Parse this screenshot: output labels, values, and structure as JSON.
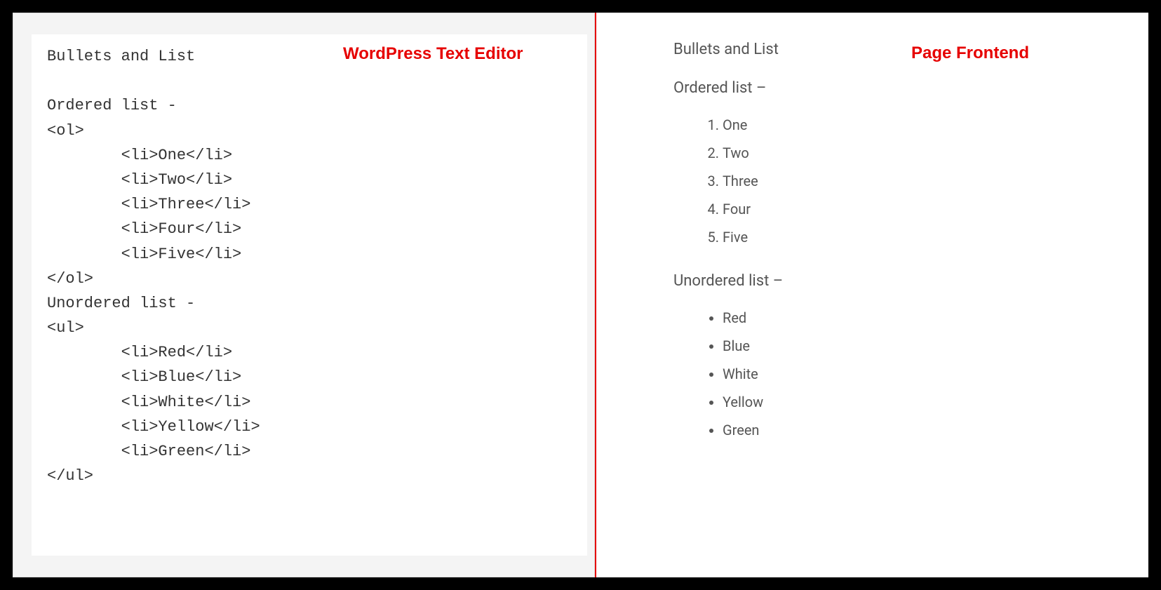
{
  "labels": {
    "left": "WordPress Text Editor",
    "right": "Page Frontend"
  },
  "editor": {
    "title_line": "Bullets and List",
    "ordered_header": "Ordered list -",
    "ol_open": "<ol>",
    "ol_items": [
      "One",
      "Two",
      "Three",
      "Four",
      "Five"
    ],
    "ol_close": "</ol>",
    "unordered_header": "Unordered list -",
    "ul_open": "<ul>",
    "ul_items": [
      "Red",
      "Blue",
      "White",
      "Yellow",
      "Green"
    ],
    "ul_close": "</ul>"
  },
  "frontend": {
    "title": "Bullets and List",
    "ordered_heading": "Ordered list –",
    "ordered_items": [
      "One",
      "Two",
      "Three",
      "Four",
      "Five"
    ],
    "unordered_heading": "Unordered list –",
    "unordered_items": [
      "Red",
      "Blue",
      "White",
      "Yellow",
      "Green"
    ]
  }
}
